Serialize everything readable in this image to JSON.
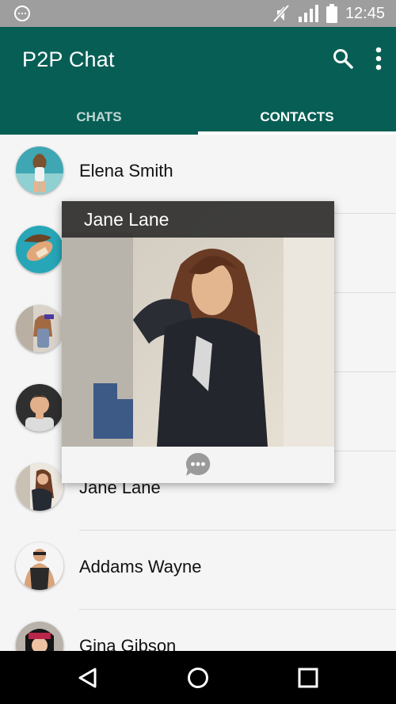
{
  "status_bar": {
    "time": "12:45",
    "icons": [
      "notification-icon",
      "mute-icon",
      "signal-icon",
      "battery-icon"
    ]
  },
  "app_bar": {
    "title": "P2P Chat",
    "actions": [
      "search-icon",
      "more-vert-icon"
    ],
    "color": "#075e54"
  },
  "tabs": [
    {
      "label": "CHATS",
      "active": false
    },
    {
      "label": "CONTACTS",
      "active": true
    }
  ],
  "contacts": [
    {
      "name": "Elena Smith"
    },
    {
      "name": ""
    },
    {
      "name": ""
    },
    {
      "name": ""
    },
    {
      "name": "Jane Lane"
    },
    {
      "name": "Addams Wayne"
    },
    {
      "name": "Gina Gibson"
    }
  ],
  "popup": {
    "name": "Jane Lane",
    "action_icon": "chat-bubble-icon"
  },
  "nav_bar": {
    "buttons": [
      "back-icon",
      "home-icon",
      "recents-icon"
    ]
  }
}
